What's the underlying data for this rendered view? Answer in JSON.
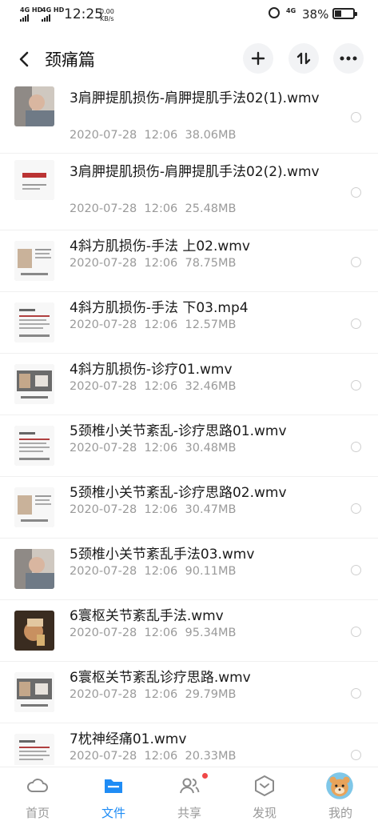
{
  "status_bar": {
    "signal1": "4G HD",
    "signal2": "4G HD",
    "time": "12:25",
    "net_speed_value": "0.00",
    "net_speed_unit": "KB/s",
    "network": "4G",
    "battery_percent": "38%",
    "battery_level": 0.38
  },
  "header": {
    "title": "颈痛篇",
    "add_icon": "plus-icon",
    "sort_icon": "sort-icon",
    "more_icon": "more-icon"
  },
  "files": [
    {
      "name": "3肩胛提肌损伤-肩胛提肌手法02(1).wmv",
      "date": "2020-07-28",
      "time": "12:06",
      "size": "38.06MB",
      "thumb": "photo"
    },
    {
      "name": "3肩胛提肌损伤-肩胛提肌手法02(2).wmv",
      "date": "2020-07-28",
      "time": "12:06",
      "size": "25.48MB",
      "thumb": "slide-title"
    },
    {
      "name": "4斜方肌损伤-手法 上02.wmv",
      "date": "2020-07-28",
      "time": "12:06",
      "size": "78.75MB",
      "thumb": "slide-photo"
    },
    {
      "name": "4斜方肌损伤-手法 下03.mp4",
      "date": "2020-07-28",
      "time": "12:06",
      "size": "12.57MB",
      "thumb": "slide-text"
    },
    {
      "name": "4斜方肌损伤-诊疗01.wmv",
      "date": "2020-07-28",
      "time": "12:06",
      "size": "32.46MB",
      "thumb": "slide-photo2"
    },
    {
      "name": "5颈椎小关节紊乱-诊疗思路01.wmv",
      "date": "2020-07-28",
      "time": "12:06",
      "size": "30.48MB",
      "thumb": "slide-text"
    },
    {
      "name": "5颈椎小关节紊乱-诊疗思路02.wmv",
      "date": "2020-07-28",
      "time": "12:06",
      "size": "30.47MB",
      "thumb": "slide-photo"
    },
    {
      "name": "5颈椎小关节紊乱手法03.wmv",
      "date": "2020-07-28",
      "time": "12:06",
      "size": "90.11MB",
      "thumb": "photo"
    },
    {
      "name": "6寰枢关节紊乱手法.wmv",
      "date": "2020-07-28",
      "time": "12:06",
      "size": "95.34MB",
      "thumb": "photo-warm"
    },
    {
      "name": "6寰枢关节紊乱诊疗思路.wmv",
      "date": "2020-07-28",
      "time": "12:06",
      "size": "29.79MB",
      "thumb": "slide-photo2"
    },
    {
      "name": "7枕神经痛01.wmv",
      "date": "2020-07-28",
      "time": "12:06",
      "size": "20.33MB",
      "thumb": "slide-text"
    }
  ],
  "tabs": [
    {
      "label": "首页",
      "icon": "cloud-icon",
      "active": false
    },
    {
      "label": "文件",
      "icon": "folder-icon",
      "active": true
    },
    {
      "label": "共享",
      "icon": "people-icon",
      "active": false,
      "badge": true
    },
    {
      "label": "发现",
      "icon": "discover-icon",
      "active": false
    },
    {
      "label": "我的",
      "icon": "avatar",
      "active": false
    }
  ],
  "colors": {
    "accent": "#1f8cf5",
    "badge": "#f04848",
    "meta_text": "#9a9a9a"
  }
}
